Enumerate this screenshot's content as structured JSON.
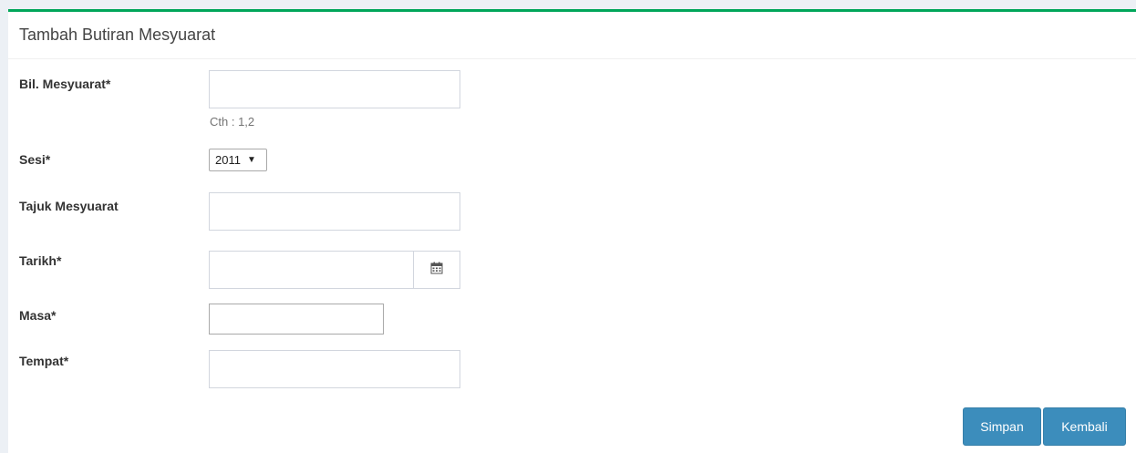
{
  "panel": {
    "title": "Tambah Butiran Mesyuarat",
    "accent_color": "#00a65a"
  },
  "form": {
    "bil_label": "Bil. Mesyuarat*",
    "bil_value": "",
    "bil_help": "Cth : 1,2",
    "sesi_label": "Sesi*",
    "sesi_selected": "2011",
    "tajuk_label": "Tajuk Mesyuarat",
    "tajuk_value": "",
    "tarikh_label": "Tarikh*",
    "tarikh_value": "",
    "tarikh_icon": "calendar-icon",
    "masa_label": "Masa*",
    "masa_value": "",
    "tempat_label": "Tempat*",
    "tempat_value": ""
  },
  "actions": {
    "save_label": "Simpan",
    "back_label": "Kembali",
    "button_color": "#3c8dbc"
  }
}
